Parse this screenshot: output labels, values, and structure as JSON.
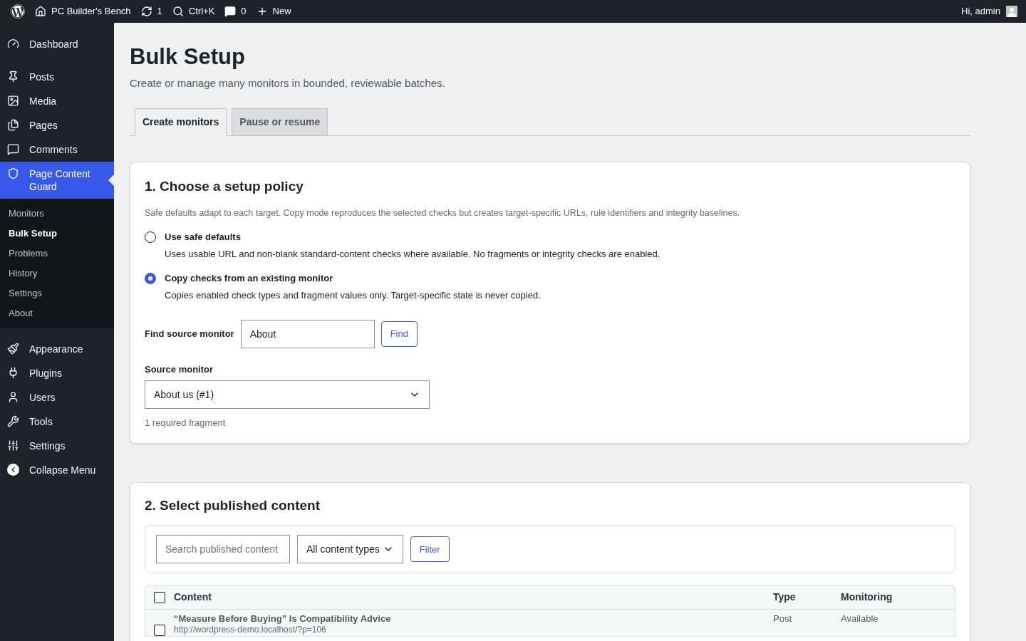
{
  "admin_bar": {
    "items": [
      {
        "kind": "logo"
      },
      {
        "kind": "site",
        "label": "PC Builder's Bench"
      },
      {
        "kind": "updates",
        "label": "1"
      },
      {
        "kind": "search",
        "label": "Ctrl+K"
      },
      {
        "kind": "comments",
        "label": "0"
      },
      {
        "kind": "new",
        "label": "New"
      }
    ],
    "greeting": "Hi, admin"
  },
  "sidebar": {
    "items": [
      {
        "kind": "dashboard",
        "label": "Dashboard",
        "selected": false
      },
      {
        "kind": "posts",
        "label": "Posts",
        "selected": false
      },
      {
        "kind": "media",
        "label": "Media",
        "selected": false
      },
      {
        "kind": "pages",
        "label": "Pages",
        "selected": false
      },
      {
        "kind": "comments",
        "label": "Comments",
        "selected": false
      },
      {
        "kind": "guard",
        "label": "Page Content Guard",
        "selected": true,
        "children": [
          {
            "label": "Monitors",
            "selected": false
          },
          {
            "label": "Bulk Setup",
            "selected": true
          },
          {
            "label": "Problems",
            "selected": false
          },
          {
            "label": "History",
            "selected": false
          },
          {
            "label": "Settings",
            "selected": false
          },
          {
            "label": "About",
            "selected": false
          }
        ]
      },
      {
        "kind": "appearance",
        "label": "Appearance",
        "selected": false
      },
      {
        "kind": "plugins",
        "label": "Plugins",
        "selected": false
      },
      {
        "kind": "users",
        "label": "Users",
        "selected": false
      },
      {
        "kind": "tools",
        "label": "Tools",
        "selected": false
      },
      {
        "kind": "settings",
        "label": "Settings",
        "selected": false
      },
      {
        "kind": "collapse",
        "label": "Collapse Menu",
        "selected": false
      }
    ]
  },
  "page": {
    "title": "Bulk Setup",
    "subtitle": "Create or manage many monitors in bounded, reviewable batches."
  },
  "tabs": [
    {
      "label": "Create monitors",
      "selected": true
    },
    {
      "label": "Pause or resume",
      "selected": false
    }
  ],
  "policy": {
    "heading": "1. Choose a setup policy",
    "description": "Safe defaults adapt to each target. Copy mode reproduces the selected checks but creates target-specific URLs, rule identifiers and integrity baselines.",
    "options": [
      {
        "label": "Use safe defaults",
        "description": "Uses usable URL and non-blank standard-content checks where available. No fragments or integrity checks are enabled.",
        "selected": false
      },
      {
        "label": "Copy checks from an existing monitor",
        "description": "Copies enabled check types and fragment values only. Target-specific state is never copied.",
        "selected": true
      }
    ],
    "find": {
      "label": "Find source monitor",
      "value": "About",
      "button": "Find"
    },
    "source": {
      "label": "Source monitor",
      "value": "About us (#1)"
    },
    "note": "1 required fragment"
  },
  "content": {
    "heading": "2. Select published content",
    "search_placeholder": "Search published content",
    "type_filter": "All content types",
    "filter_button": "Filter",
    "table": {
      "all_checked": false,
      "columns": [
        "Content",
        "Type",
        "Monitoring"
      ],
      "rows": [
        {
          "title": "“Measure Before Buying” Is Compatibility Advice",
          "url": "http://wordpress-demo.localhost/?p=106",
          "type": "Post",
          "monitoring": "Available",
          "checked": false
        }
      ]
    }
  }
}
